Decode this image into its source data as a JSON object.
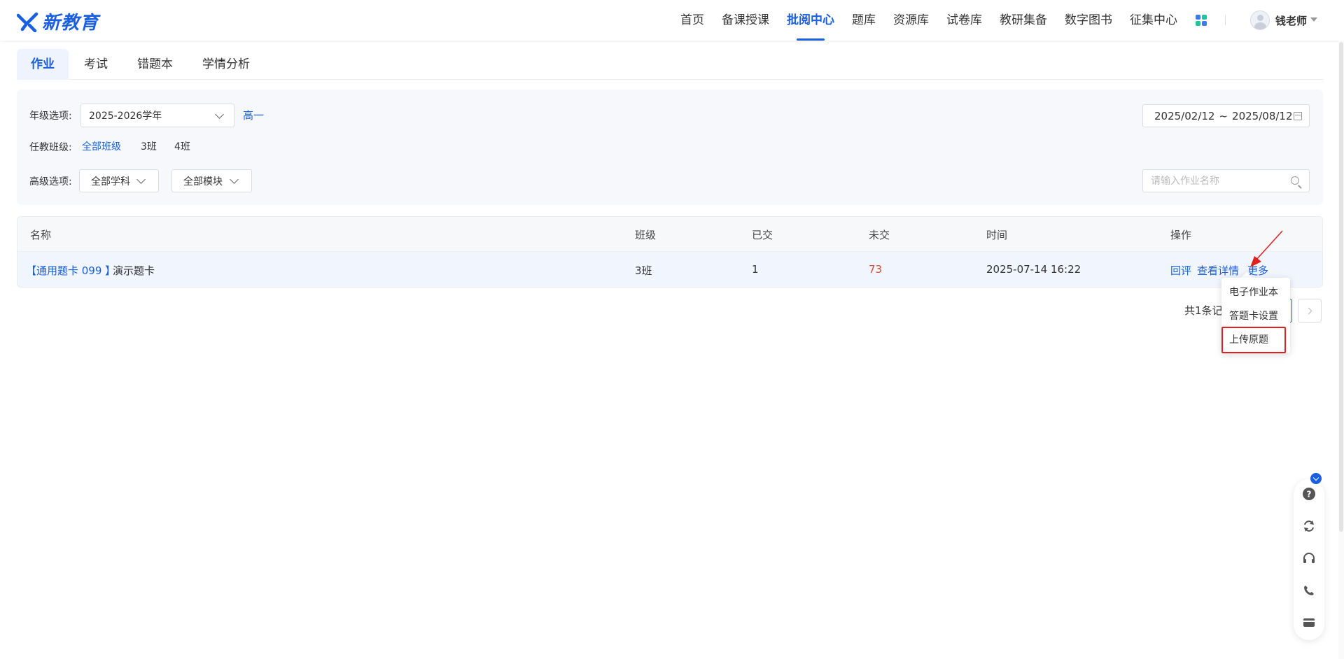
{
  "header": {
    "logo_text": "新教育",
    "nav": [
      "首页",
      "备课授课",
      "批阅中心",
      "题库",
      "资源库",
      "试卷库",
      "教研集备",
      "数字图书",
      "征集中心"
    ],
    "active_nav": "批阅中心",
    "user_name": "钱老师",
    "brand_color": "#1a5fe0"
  },
  "tabs": [
    "作业",
    "考试",
    "错题本",
    "学情分析"
  ],
  "filter": {
    "grade_label": "年级选项:",
    "year_value": "2025-2026学年",
    "grade_link": "高一",
    "class_label": "任教班级:",
    "classes": [
      "全部班级",
      "3班",
      "4班"
    ],
    "advanced_label": "高级选项:",
    "subject": "全部学科",
    "module": "全部模块",
    "date_start": "2025/02/12",
    "date_sep": "~",
    "date_end": "2025/08/12",
    "search_placeholder": "请输入作业名称"
  },
  "table": {
    "headers": [
      "名称",
      "班级",
      "已交",
      "未交",
      "时间",
      "操作"
    ],
    "rows": [
      {
        "tag": "【通用题卡 099 】",
        "name": "演示题卡",
        "class": "3班",
        "submitted": "1",
        "not_submitted": "73",
        "time": "2025-07-14 16:22",
        "actions": [
          "回评",
          "查看详情",
          "更多"
        ]
      }
    ]
  },
  "pagination": {
    "total_text": "共1条记"
  },
  "more_menu": [
    "电子作业本",
    "答题卡设置",
    "上传原题"
  ],
  "float_icons": [
    "help-icon",
    "refresh-icon",
    "headset-icon",
    "phone-icon",
    "card-icon"
  ]
}
